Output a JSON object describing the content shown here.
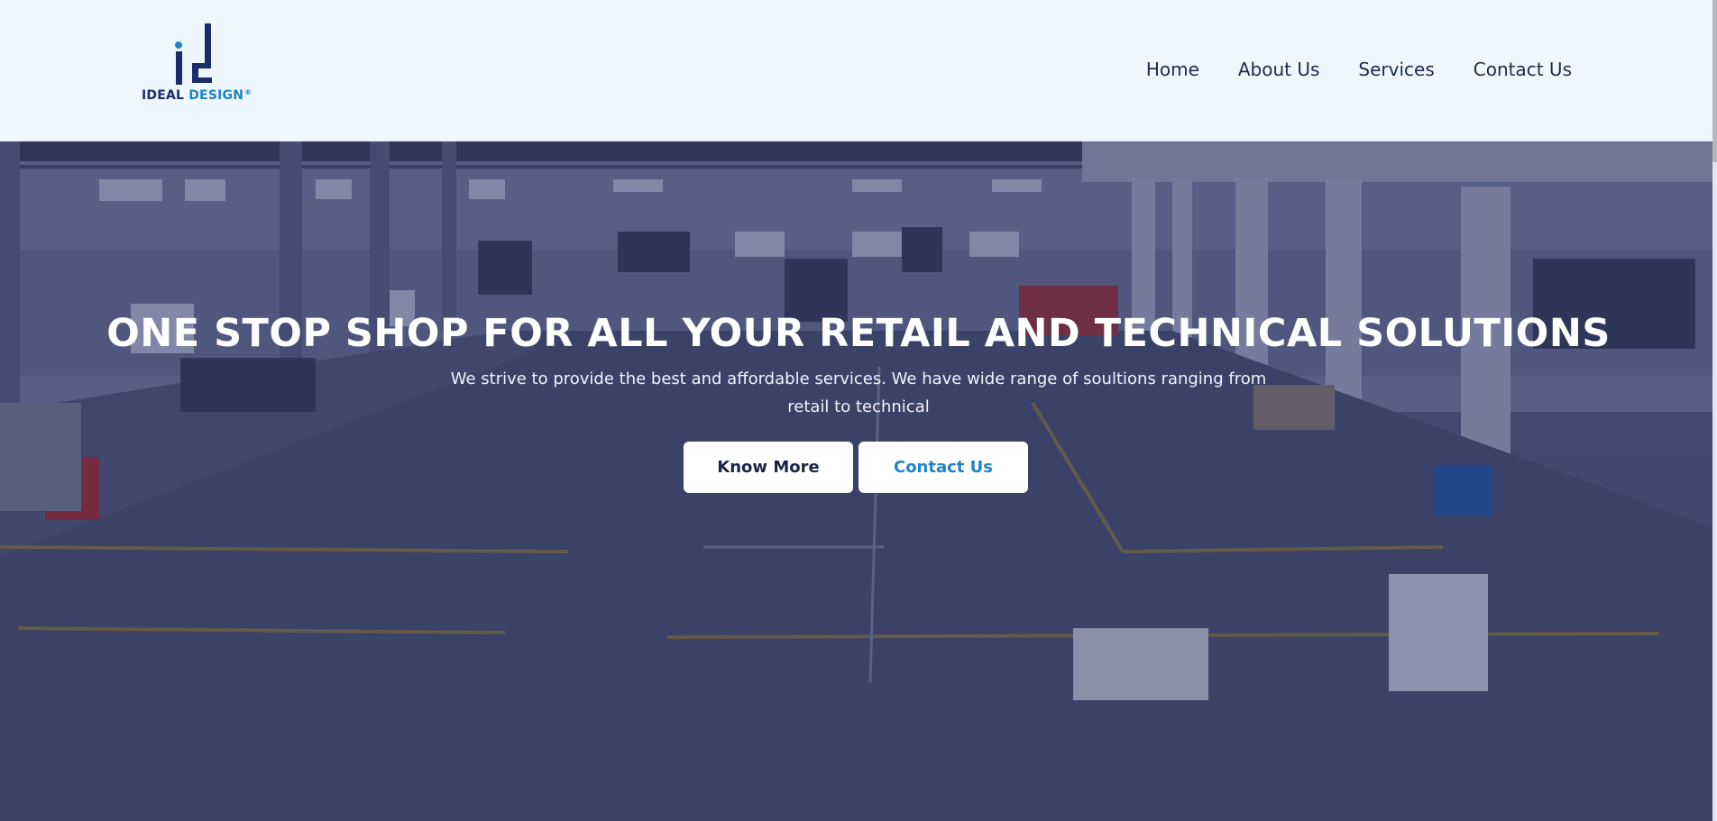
{
  "brand": {
    "word1": "IDEAL",
    "word2": "DESIGN",
    "registered": "®"
  },
  "nav": {
    "items": [
      "Home",
      "About Us",
      "Services",
      "Contact Us"
    ]
  },
  "hero": {
    "title": "ONE STOP SHOP FOR ALL YOUR RETAIL AND TECHNICAL SOLUTIONS",
    "subtitle": "We strive to provide the best and affordable services. We have wide range of soultions ranging from retail to technical",
    "know_more": "Know More",
    "contact_us": "Contact Us"
  },
  "colors": {
    "header_bg": "#eef7fd",
    "brand_dark": "#1b2d6b",
    "brand_blue": "#1e84c8",
    "nav_text": "#1d2b48"
  }
}
